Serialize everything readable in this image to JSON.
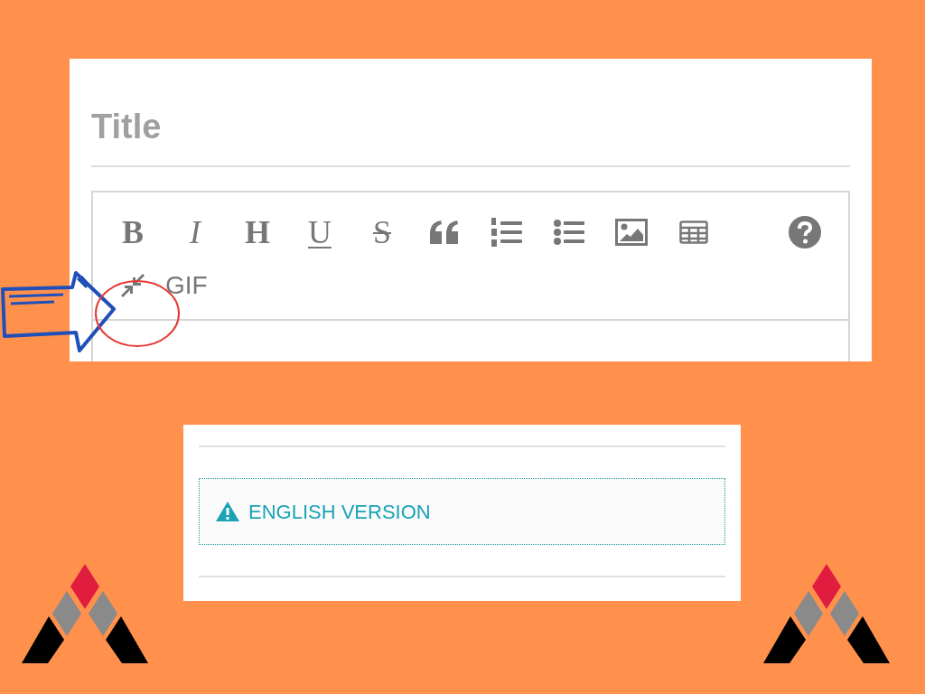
{
  "editor": {
    "title_field": {
      "placeholder": "Title"
    },
    "toolbar": {
      "format_buttons": [
        {
          "label": "B"
        },
        {
          "label": "I"
        },
        {
          "label": "H"
        },
        {
          "label": "U"
        },
        {
          "label": "S"
        }
      ],
      "gif_button": {
        "label": "GIF"
      }
    }
  },
  "notice": {
    "label": "ENGLISH VERSION"
  }
}
